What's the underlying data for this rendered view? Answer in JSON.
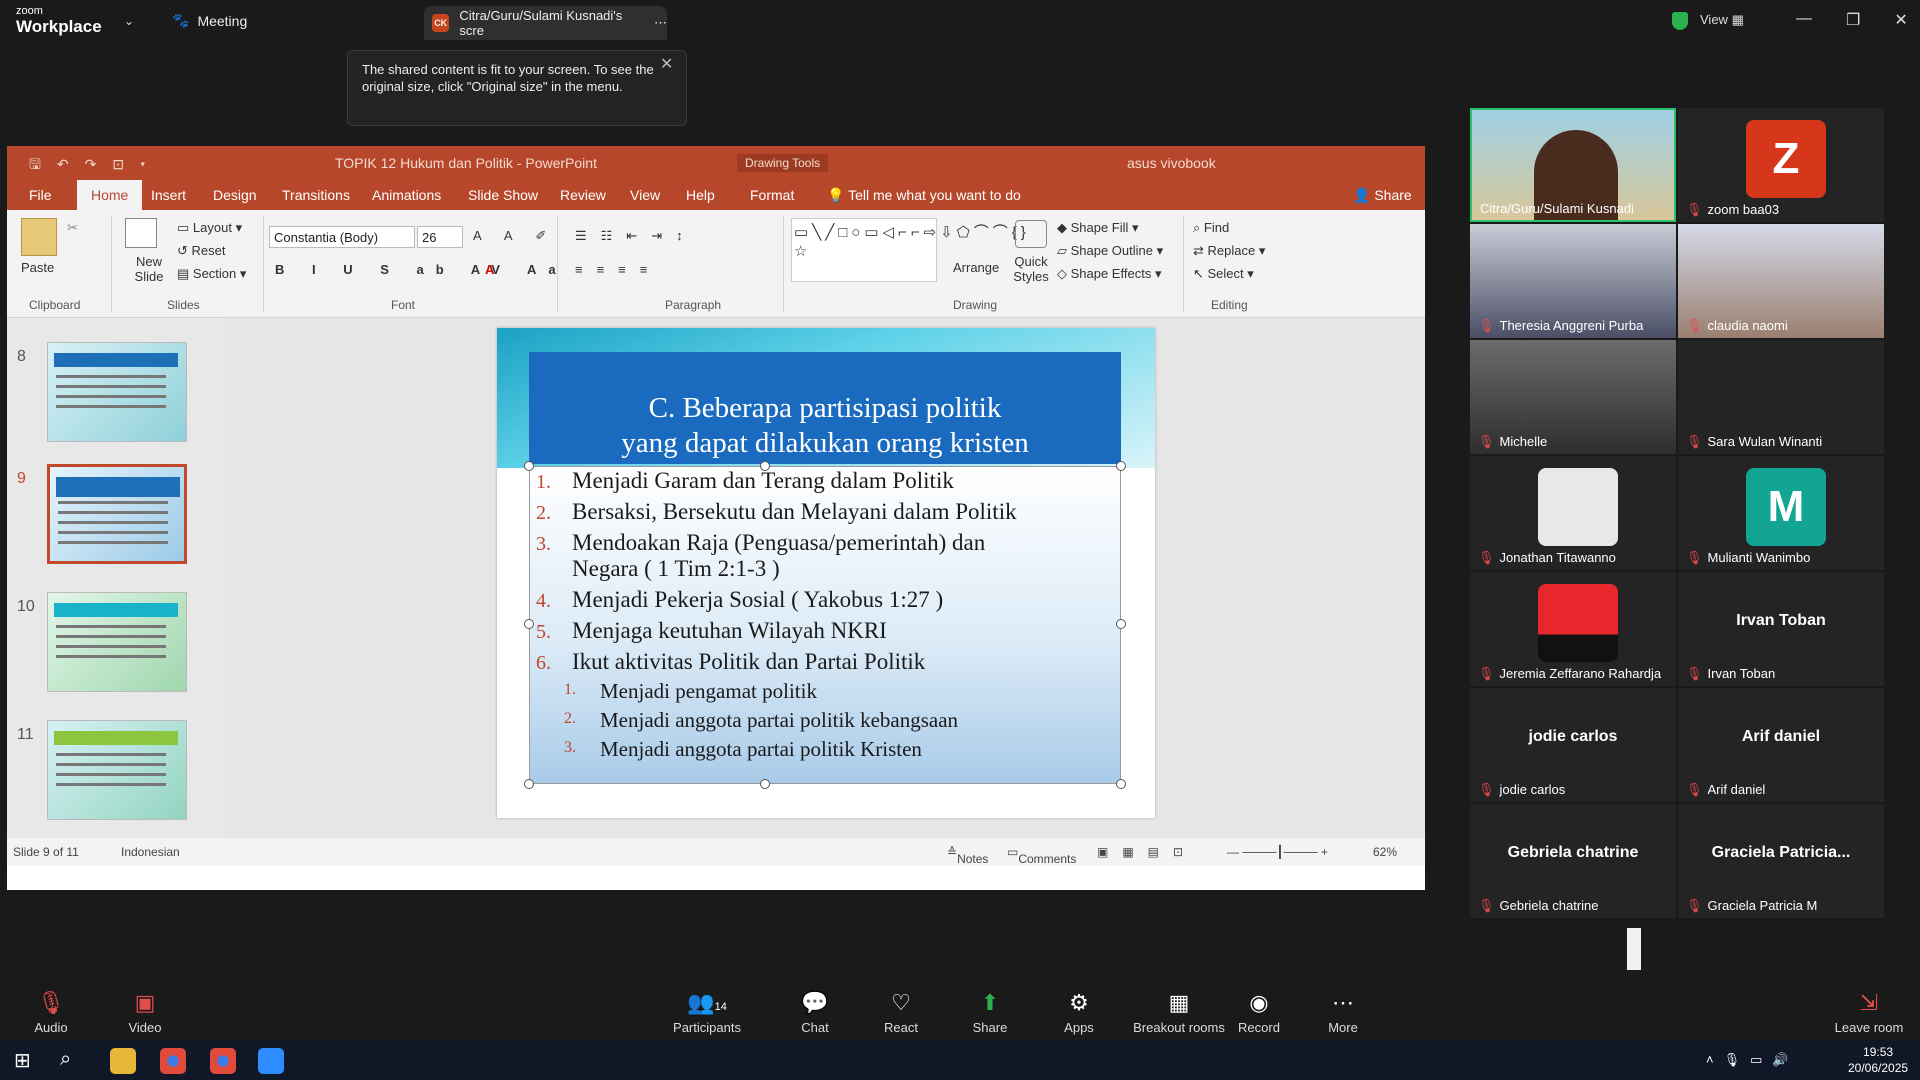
{
  "zoom": {
    "logo_top": "zoom",
    "logo_bottom": "Workplace",
    "meeting": "Meeting",
    "share_tab": "Citra/Guru/Sulami Kusnadi's scre",
    "view": "View"
  },
  "tooltip": "The shared content is fit to your screen. To see the original size, click \"Original size\" in the menu.",
  "ppt": {
    "title": "TOPIK 12 Hukum dan Politik - PowerPoint",
    "drawing_tools": "Drawing Tools",
    "user": "asus vivobook",
    "menu": [
      "File",
      "Home",
      "Insert",
      "Design",
      "Transitions",
      "Animations",
      "Slide Show",
      "Review",
      "View",
      "Help",
      "Format"
    ],
    "tell_me": "Tell me what you want to do",
    "share": "Share",
    "ribbon": {
      "paste": "Paste",
      "new_slide": "New Slide",
      "layout": "Layout",
      "reset": "Reset",
      "section": "Section",
      "font": "Constantia (Body)",
      "size": "26",
      "shape_fill": "Shape Fill",
      "shape_outline": "Shape Outline",
      "shape_effects": "Shape Effects",
      "arrange": "Arrange",
      "quick_styles": "Quick Styles",
      "find": "Find",
      "replace": "Replace",
      "select": "Select"
    },
    "groups": [
      "Clipboard",
      "Slides",
      "Font",
      "Paragraph",
      "Drawing",
      "Editing"
    ],
    "thumb_numbers": [
      "8",
      "9",
      "10",
      "11"
    ],
    "slide": {
      "title_line1": "C.  Beberapa partisipasi politik",
      "title_line2": "yang dapat dilakukan orang kristen",
      "items": [
        {
          "n": "1.",
          "t": "Menjadi Garam dan Terang dalam Politik"
        },
        {
          "n": "2.",
          "t": "Bersaksi, Bersekutu dan Melayani dalam Politik"
        },
        {
          "n": "3.",
          "t": "Mendoakan Raja (Penguasa/pemerintah) dan"
        },
        {
          "n": "",
          "t": "Negara ( 1 Tim 2:1-3 )"
        },
        {
          "n": "4.",
          "t": "Menjadi Pekerja Sosial ( Yakobus 1:27 )"
        },
        {
          "n": "5.",
          "t": "Menjaga keutuhan Wilayah NKRI"
        },
        {
          "n": "6.",
          "t": "Ikut aktivitas Politik dan Partai Politik"
        }
      ],
      "subitems": [
        {
          "n": "1.",
          "t": "Menjadi pengamat politik"
        },
        {
          "n": "2.",
          "t": "Menjadi anggota partai politik kebangsaan"
        },
        {
          "n": "3.",
          "t": "Menjadi anggota partai politik Kristen"
        }
      ]
    },
    "status": {
      "slide": "Slide 9 of 11",
      "lang": "Indonesian",
      "notes": "Notes",
      "comments": "Comments",
      "zoom": "62%"
    }
  },
  "participants": [
    {
      "name": "Citra/Guru/Sulami Kusnadi",
      "video": true
    },
    {
      "name": "zoom baa03",
      "avatar": "Z",
      "color": "#d6361a"
    },
    {
      "name": "Theresia Anggreni Purba",
      "video": true
    },
    {
      "name": "claudia naomi",
      "video": true
    },
    {
      "name": "Michelle",
      "video": true
    },
    {
      "name": "Sara Wulan Winanti"
    },
    {
      "name": "Jonathan Titawanno",
      "avatar": ""
    },
    {
      "name": "Mulianti Wanimbo",
      "avatar": "M",
      "color": "#12a594"
    },
    {
      "name": "Jeremia Zeffarano Rahardja",
      "avatar": ""
    },
    {
      "name": "Irvan Toban",
      "big": "Irvan Toban"
    },
    {
      "name": "jodie carlos",
      "big": "jodie carlos"
    },
    {
      "name": "Arif daniel",
      "big": "Arif daniel"
    },
    {
      "name": "Gebriela chatrine",
      "big": "Gebriela chatrine"
    },
    {
      "name": "Graciela Patricia M",
      "big": "Graciela  Patricia..."
    }
  ],
  "toolbar": {
    "audio": "Audio",
    "video": "Video",
    "participants": "Participants",
    "participants_count": "14",
    "chat": "Chat",
    "react": "React",
    "share": "Share",
    "apps": "Apps",
    "breakout": "Breakout rooms",
    "record": "Record",
    "more": "More",
    "leave": "Leave room"
  },
  "clock": {
    "time": "19:53",
    "date": "20/06/2025"
  }
}
